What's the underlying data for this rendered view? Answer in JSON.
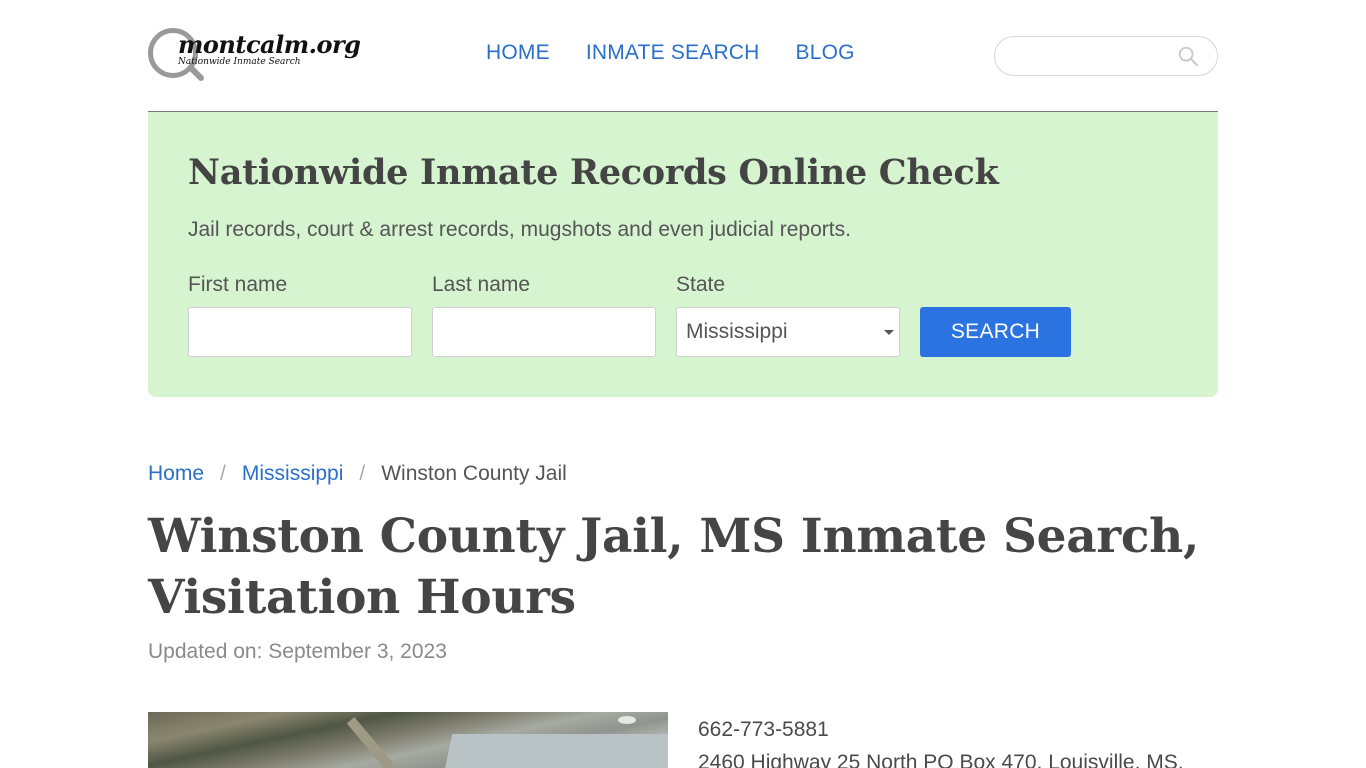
{
  "logo": {
    "title": "montcalm.org",
    "subtitle": "Nationwide Inmate Search"
  },
  "nav": {
    "home": "HOME",
    "inmate_search": "INMATE SEARCH",
    "blog": "BLOG"
  },
  "header_search": {
    "value": "",
    "placeholder": ""
  },
  "hero": {
    "title": "Nationwide Inmate Records Online Check",
    "subtitle": "Jail records, court & arrest records, mugshots and even judicial reports.",
    "first_name_label": "First name",
    "first_name_value": "",
    "last_name_label": "Last name",
    "last_name_value": "",
    "state_label": "State",
    "state_value": "Mississippi",
    "search_button": "SEARCH"
  },
  "breadcrumb": {
    "home": "Home",
    "state": "Mississippi",
    "current": "Winston County Jail",
    "separator": "/"
  },
  "page": {
    "title": "Winston County Jail, MS Inmate Search, Visitation Hours",
    "updated": "Updated on: September 3, 2023"
  },
  "contact": {
    "phone": "662-773-5881",
    "address": "2460 Highway 25 North PO Box 470, Louisville, MS,"
  },
  "colors": {
    "link": "#2a6fc9",
    "hero_bg": "#d6f4d0",
    "button": "#2a73e0"
  },
  "icons": {
    "search": "search-icon",
    "select": "chevron-down-icon"
  }
}
